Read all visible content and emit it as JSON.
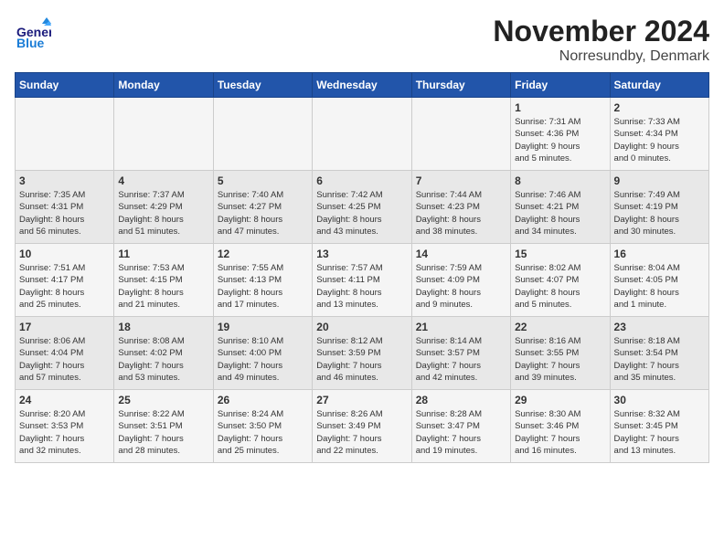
{
  "logo": {
    "text_general": "General",
    "text_blue": "Blue"
  },
  "title": "November 2024",
  "location": "Norresundby, Denmark",
  "header_days": [
    "Sunday",
    "Monday",
    "Tuesday",
    "Wednesday",
    "Thursday",
    "Friday",
    "Saturday"
  ],
  "weeks": [
    [
      {
        "day": "",
        "info": ""
      },
      {
        "day": "",
        "info": ""
      },
      {
        "day": "",
        "info": ""
      },
      {
        "day": "",
        "info": ""
      },
      {
        "day": "",
        "info": ""
      },
      {
        "day": "1",
        "info": "Sunrise: 7:31 AM\nSunset: 4:36 PM\nDaylight: 9 hours\nand 5 minutes."
      },
      {
        "day": "2",
        "info": "Sunrise: 7:33 AM\nSunset: 4:34 PM\nDaylight: 9 hours\nand 0 minutes."
      }
    ],
    [
      {
        "day": "3",
        "info": "Sunrise: 7:35 AM\nSunset: 4:31 PM\nDaylight: 8 hours\nand 56 minutes."
      },
      {
        "day": "4",
        "info": "Sunrise: 7:37 AM\nSunset: 4:29 PM\nDaylight: 8 hours\nand 51 minutes."
      },
      {
        "day": "5",
        "info": "Sunrise: 7:40 AM\nSunset: 4:27 PM\nDaylight: 8 hours\nand 47 minutes."
      },
      {
        "day": "6",
        "info": "Sunrise: 7:42 AM\nSunset: 4:25 PM\nDaylight: 8 hours\nand 43 minutes."
      },
      {
        "day": "7",
        "info": "Sunrise: 7:44 AM\nSunset: 4:23 PM\nDaylight: 8 hours\nand 38 minutes."
      },
      {
        "day": "8",
        "info": "Sunrise: 7:46 AM\nSunset: 4:21 PM\nDaylight: 8 hours\nand 34 minutes."
      },
      {
        "day": "9",
        "info": "Sunrise: 7:49 AM\nSunset: 4:19 PM\nDaylight: 8 hours\nand 30 minutes."
      }
    ],
    [
      {
        "day": "10",
        "info": "Sunrise: 7:51 AM\nSunset: 4:17 PM\nDaylight: 8 hours\nand 25 minutes."
      },
      {
        "day": "11",
        "info": "Sunrise: 7:53 AM\nSunset: 4:15 PM\nDaylight: 8 hours\nand 21 minutes."
      },
      {
        "day": "12",
        "info": "Sunrise: 7:55 AM\nSunset: 4:13 PM\nDaylight: 8 hours\nand 17 minutes."
      },
      {
        "day": "13",
        "info": "Sunrise: 7:57 AM\nSunset: 4:11 PM\nDaylight: 8 hours\nand 13 minutes."
      },
      {
        "day": "14",
        "info": "Sunrise: 7:59 AM\nSunset: 4:09 PM\nDaylight: 8 hours\nand 9 minutes."
      },
      {
        "day": "15",
        "info": "Sunrise: 8:02 AM\nSunset: 4:07 PM\nDaylight: 8 hours\nand 5 minutes."
      },
      {
        "day": "16",
        "info": "Sunrise: 8:04 AM\nSunset: 4:05 PM\nDaylight: 8 hours\nand 1 minute."
      }
    ],
    [
      {
        "day": "17",
        "info": "Sunrise: 8:06 AM\nSunset: 4:04 PM\nDaylight: 7 hours\nand 57 minutes."
      },
      {
        "day": "18",
        "info": "Sunrise: 8:08 AM\nSunset: 4:02 PM\nDaylight: 7 hours\nand 53 minutes."
      },
      {
        "day": "19",
        "info": "Sunrise: 8:10 AM\nSunset: 4:00 PM\nDaylight: 7 hours\nand 49 minutes."
      },
      {
        "day": "20",
        "info": "Sunrise: 8:12 AM\nSunset: 3:59 PM\nDaylight: 7 hours\nand 46 minutes."
      },
      {
        "day": "21",
        "info": "Sunrise: 8:14 AM\nSunset: 3:57 PM\nDaylight: 7 hours\nand 42 minutes."
      },
      {
        "day": "22",
        "info": "Sunrise: 8:16 AM\nSunset: 3:55 PM\nDaylight: 7 hours\nand 39 minutes."
      },
      {
        "day": "23",
        "info": "Sunrise: 8:18 AM\nSunset: 3:54 PM\nDaylight: 7 hours\nand 35 minutes."
      }
    ],
    [
      {
        "day": "24",
        "info": "Sunrise: 8:20 AM\nSunset: 3:53 PM\nDaylight: 7 hours\nand 32 minutes."
      },
      {
        "day": "25",
        "info": "Sunrise: 8:22 AM\nSunset: 3:51 PM\nDaylight: 7 hours\nand 28 minutes."
      },
      {
        "day": "26",
        "info": "Sunrise: 8:24 AM\nSunset: 3:50 PM\nDaylight: 7 hours\nand 25 minutes."
      },
      {
        "day": "27",
        "info": "Sunrise: 8:26 AM\nSunset: 3:49 PM\nDaylight: 7 hours\nand 22 minutes."
      },
      {
        "day": "28",
        "info": "Sunrise: 8:28 AM\nSunset: 3:47 PM\nDaylight: 7 hours\nand 19 minutes."
      },
      {
        "day": "29",
        "info": "Sunrise: 8:30 AM\nSunset: 3:46 PM\nDaylight: 7 hours\nand 16 minutes."
      },
      {
        "day": "30",
        "info": "Sunrise: 8:32 AM\nSunset: 3:45 PM\nDaylight: 7 hours\nand 13 minutes."
      }
    ]
  ]
}
